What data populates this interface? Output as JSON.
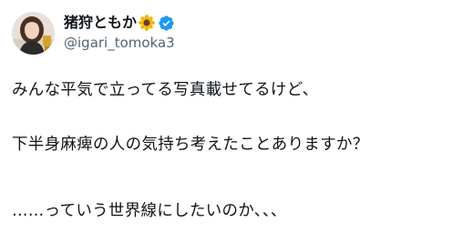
{
  "user": {
    "display_name": "猪狩ともか",
    "name_emoji": "sunflower-icon",
    "verified_icon": "verified-badge-icon",
    "handle": "@igari_tomoka3",
    "avatar_icon": "profile-avatar"
  },
  "tweet": {
    "lines": [
      "みんな平気で立ってる写真載せてるけど、",
      "下半身麻痺の人の気持ち考えたことありますか？",
      "……っていう世界線にしたいのか、、、"
    ]
  },
  "colors": {
    "text": "#0f1419",
    "secondary": "#536471",
    "verified": "#1d9bf0",
    "sunflower_petal": "#f7b500",
    "sunflower_center": "#6b3e1e"
  }
}
